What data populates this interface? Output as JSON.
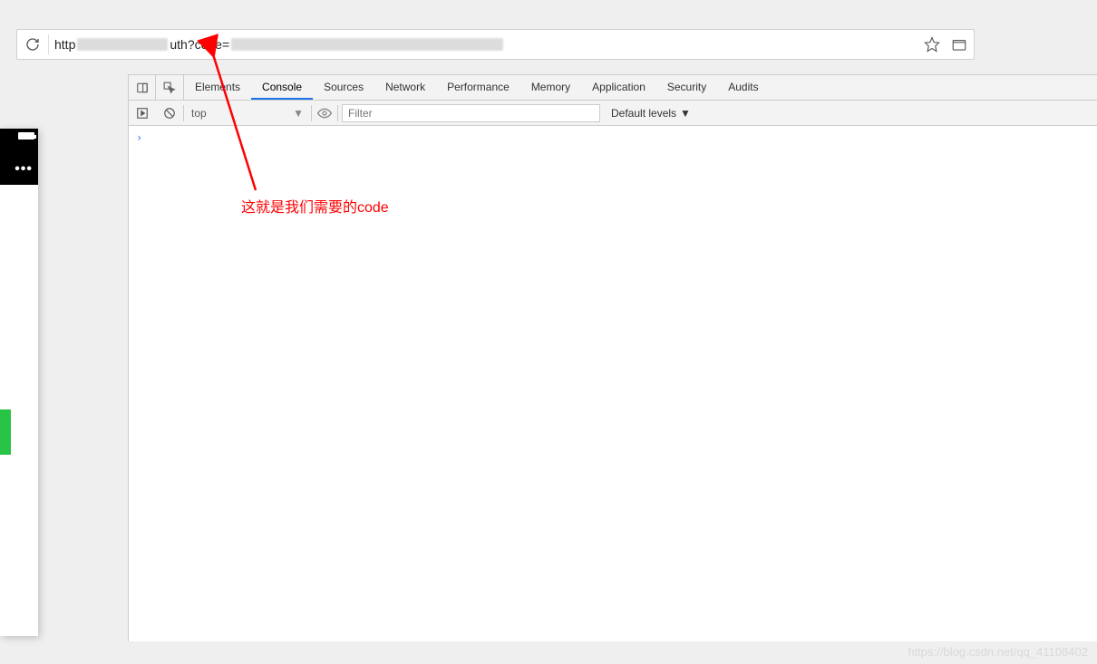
{
  "address_bar": {
    "url_prefix": "http",
    "url_mid": "uth?code="
  },
  "devtools": {
    "tabs": [
      "Elements",
      "Console",
      "Sources",
      "Network",
      "Performance",
      "Memory",
      "Application",
      "Security",
      "Audits"
    ],
    "active_tab_index": 1,
    "toolbar": {
      "context_label": "top",
      "filter_placeholder": "Filter",
      "levels_label": "Default levels"
    },
    "prompt": "›"
  },
  "annotation": {
    "text": "这就是我们需要的code"
  },
  "watermark": "https://blog.csdn.net/qq_41108402",
  "mobile": {
    "dots": "•••"
  }
}
